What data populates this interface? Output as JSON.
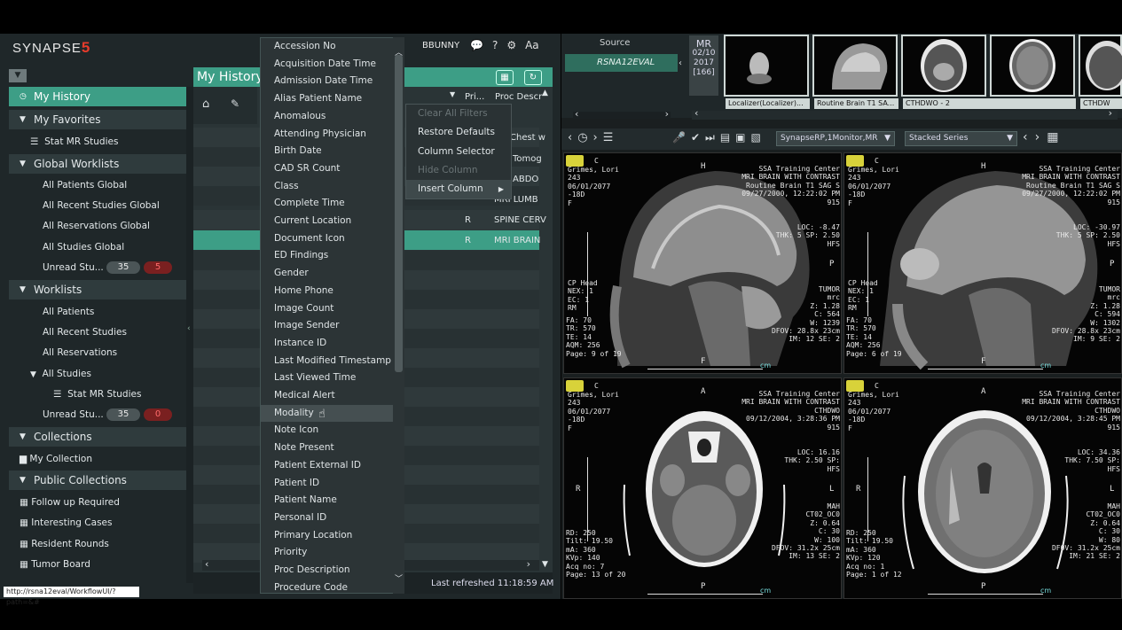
{
  "app": {
    "logo": "SYNAPSE",
    "logo_num": "5",
    "user": "BBUNNY",
    "icons": [
      "chat-icon",
      "help-icon",
      "gear-icon",
      "font-size-icon"
    ],
    "text_size_label": "Aa"
  },
  "sidebar": {
    "my_history": "My History",
    "my_favorites": "My Favorites",
    "stat_mr_studies": "Stat MR Studies",
    "global_worklists": "Global Worklists",
    "global_items": [
      "All Patients Global",
      "All Recent Studies Global",
      "All Reservations Global",
      "All Studies Global",
      "Unread Stu..."
    ],
    "global_unread_count": "35",
    "global_unread_red": "5",
    "worklists": "Worklists",
    "worklist_items": [
      "All Patients",
      "All Recent Studies",
      "All Reservations",
      "All Studies",
      "Stat MR Studies",
      "Unread Stu..."
    ],
    "worklist_unread_count": "35",
    "worklist_unread_red": "0",
    "collections": "Collections",
    "my_collection": "My Collection",
    "public_collections": "Public Collections",
    "public_items": [
      "Follow up Required",
      "Interesting Cases",
      "Resident Rounds",
      "Tumor Board"
    ]
  },
  "worklist": {
    "title": "My History",
    "col_pri": "Pri...",
    "col_proc": "Proc Descr",
    "rows": [
      {
        "pri": "",
        "proc": "Chest w"
      },
      {
        "pri": "",
        "proc": "Tomog"
      },
      {
        "pri": "",
        "proc": "ABDO"
      },
      {
        "pri": "",
        "proc": "MRI LUMB"
      },
      {
        "pri": "R",
        "proc": "SPINE CERV"
      },
      {
        "pri": "R",
        "proc": "MRI BRAIN"
      }
    ],
    "last_refreshed": "Last refreshed 11:18:59 AM"
  },
  "column_menu": {
    "items": [
      "Accession No",
      "Acquisition Date Time",
      "Admission Date Time",
      "Alias Patient Name",
      "Anomalous",
      "Attending Physician",
      "Birth Date",
      "CAD SR Count",
      "Class",
      "Complete Time",
      "Current Location",
      "Document Icon",
      "ED Findings",
      "Gender",
      "Home Phone",
      "Image Count",
      "Image Sender",
      "Instance ID",
      "Last Modified Timestamp",
      "Last Viewed Time",
      "Medical Alert",
      "Modality",
      "Note Icon",
      "Note Present",
      "Patient External ID",
      "Patient ID",
      "Patient Name",
      "Personal ID",
      "Primary Location",
      "Priority",
      "Proc Description",
      "Procedure Code"
    ],
    "highlighted": "Modality"
  },
  "context_menu": {
    "clear_filters": "Clear All Filters",
    "restore_defaults": "Restore Defaults",
    "column_selector": "Column Selector",
    "hide_column": "Hide Column",
    "insert_column": "Insert Column"
  },
  "status_url": "http://rsna12eval/WorkflowUI/?path=&#",
  "viewer": {
    "source_label": "Source",
    "source_value": "RSNA12EVAL",
    "study_modality": "MR",
    "study_date": "02/10",
    "study_year": "2017",
    "study_count": "[166]",
    "thumb_labels": [
      "Localizer(Localizer)...",
      "Routine Brain T1 SA...",
      "CTHDWO - 2",
      "",
      "CTHDW"
    ],
    "layout_dropdown": "SynapseRP,1Monitor,MR",
    "series_dropdown": "Stacked Series",
    "viewports": [
      {
        "tl": "Grimes, Lori\n243\n06/01/2077\n-18D\nF",
        "tr": "SSA Training Center\nMRI BRAIN WITH CONTRAST\nRoutine Brain T1 SAG S\n09/27/2000, 12:22:02 PM\n915",
        "rmid": "LOC: -8.47\nTHK: 5 SP: 2.50\nHFS",
        "lm": "CP Head\nNEX: 1\nEC: 1\nRM",
        "bl": "FA: 70\nTR: 570\nTE: 14\nAQM: 256\nPage: 9 of 19",
        "br": "TUMOR\nmrc\nZ: 1.28\nC: 564\nW: 1239\nDFOV: 28.8x 23cm\nIM: 12 SE: 2",
        "top_marker": "H",
        "right_marker": "P",
        "bottom_marker": "F"
      },
      {
        "tl": "Grimes, Lori\n243\n06/01/2077\n-18D\nF",
        "tr": "SSA Training Center\nMRI BRAIN WITH CONTRAST\nRoutine Brain T1 SAG S\n09/27/2000, 12:22:02 PM\n915",
        "rmid": "LOC: -30.97\nTHK: 5 SP: 2.50\nHFS",
        "lm": "CP Head\nNEX: 1\nEC: 1\nRM",
        "bl": "FA: 70\nTR: 570\nTE: 14\nAQM: 256\nPage: 6 of 19",
        "br": "TUMOR\nmrc\nZ: 1.28\nC: 594\nW: 1302\nDFOV: 28.8x 23cm\nIM: 9 SE: 2",
        "top_marker": "H",
        "right_marker": "P",
        "bottom_marker": "F"
      },
      {
        "tl": "Grimes, Lori\n243\n06/01/2077\n-18D\nF",
        "tr": "SSA Training Center\nMRI BRAIN WITH CONTRAST\nCTHDWO\n09/12/2004, 3:28:36 PM\n915",
        "rmid": "LOC: 16.16\nTHK: 2.50 SP:\nHFS",
        "lm": "",
        "bl": "RD: 250\nTilt: 19.50\nmA: 360\nKVp: 140\nAcq no: 7\nPage: 13 of 20",
        "br": "MAH\nCT02_OC0\nZ: 0.64\nC: 30\nW: 100\nDFOV: 31.2x 25cm\nIM: 13 SE: 2",
        "top_marker": "A",
        "right_marker": "L",
        "left_marker": "R",
        "bottom_marker": "P"
      },
      {
        "tl": "Grimes, Lori\n243\n06/01/2077\n-18D\nF",
        "tr": "SSA Training Center\nMRI BRAIN WITH CONTRAST\nCTHDWO\n09/12/2004, 3:28:45 PM\n915",
        "rmid": "LOC: 34.36\nTHK: 7.50 SP:\nHFS",
        "lm": "",
        "bl": "RD: 250\nTilt: 19.50\nmA: 360\nKVp: 120\nAcq no: 1\nPage: 1 of 12",
        "br": "MAH\nCT02_OC0\nZ: 0.64\nC: 30\nW: 80\nDFOV: 31.2x 25cm\nIM: 21 SE: 2",
        "top_marker": "A",
        "right_marker": "L",
        "left_marker": "R",
        "bottom_marker": "P"
      }
    ],
    "cm_label": "cm",
    "orient_c": "C"
  },
  "colors": {
    "accent": "#3d9e86",
    "panel": "#1f2729",
    "menu": "#2c3436",
    "marker": "#d8d23a"
  }
}
